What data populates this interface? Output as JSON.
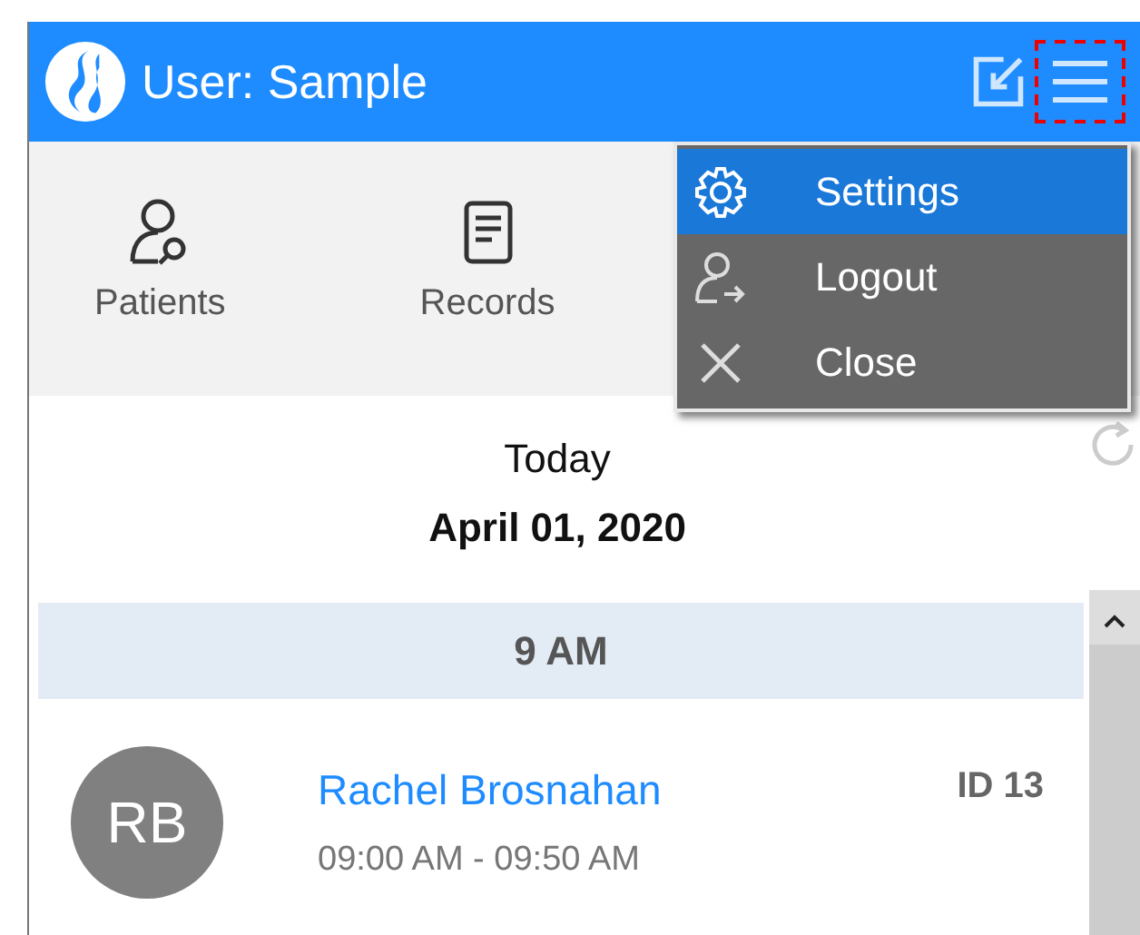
{
  "header": {
    "title": "User: Sample"
  },
  "nav": [
    {
      "label": "Patients",
      "kind": "patients"
    },
    {
      "label": "Records",
      "kind": "records"
    }
  ],
  "menu": {
    "items": [
      {
        "label": "Settings",
        "kind": "settings",
        "selected": true
      },
      {
        "label": "Logout",
        "kind": "logout",
        "selected": false
      },
      {
        "label": "Close",
        "kind": "close",
        "selected": false
      }
    ]
  },
  "day": {
    "label": "Today",
    "date": "April 01, 2020"
  },
  "groups": [
    {
      "hour": "9 AM",
      "appointments": [
        {
          "initials": "RB",
          "name": "Rachel Brosnahan",
          "id": "ID 13",
          "time": "09:00 AM - 09:50 AM"
        }
      ]
    }
  ]
}
